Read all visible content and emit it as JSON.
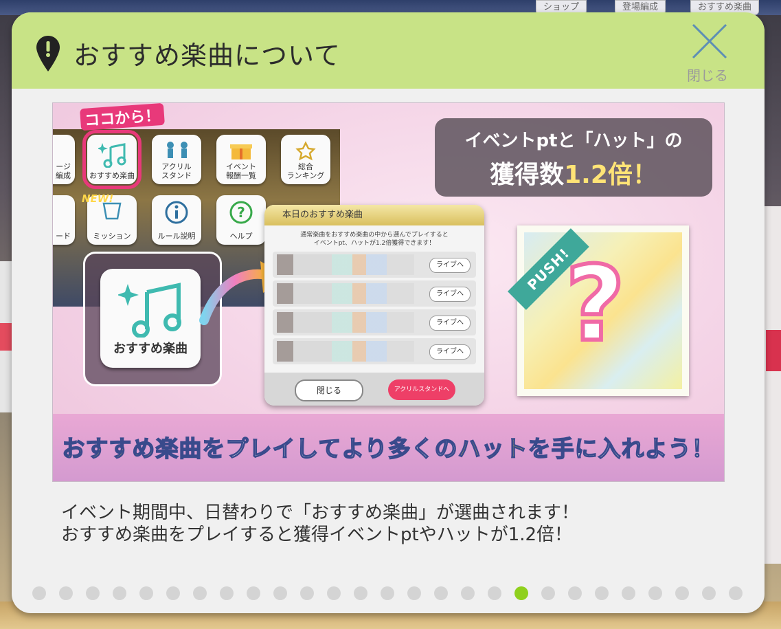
{
  "backdrop": {
    "tabs": [
      "ショップ",
      "登場編成",
      "おすすめ楽曲"
    ]
  },
  "modal": {
    "title": "おすすめ楽曲について",
    "close_label": "閉じる"
  },
  "banner": {
    "start_here": "ココから！",
    "new_tag": "NEW!",
    "tiles": [
      {
        "label": "ージ\n編成"
      },
      {
        "label": "おすすめ楽曲"
      },
      {
        "label": "アクリル\nスタンド"
      },
      {
        "label": "イベント\n報酬一覧"
      },
      {
        "label": "総合\nランキング"
      },
      {
        "label": "ード"
      },
      {
        "label": "ミッション"
      },
      {
        "label": "ルール説明"
      },
      {
        "label": "ヘルプ"
      }
    ],
    "zoom_label": "おすすめ楽曲",
    "dialog": {
      "title": "本日のおすすめ楽曲",
      "desc_line1": "通常楽曲をおすすめ楽曲の中から選んでプレイすると",
      "desc_line2": "イベントpt、ハットが1.2倍獲得できます！",
      "live_label": "ライブへ",
      "close_label": "閉じる",
      "acryl_label": "アクリルスタンドへ"
    },
    "pt_line1": "イベントptと「ハット」の",
    "pt_line2_a": "獲得数",
    "pt_line2_b": "1.2倍！",
    "push_label": "PUSH!",
    "caption_a": "おすすめ楽曲",
    "caption_b": "をプレイしてより多くの",
    "caption_c": "ハット",
    "caption_d": "を手に入れよう！"
  },
  "description": {
    "line1": "イベント期間中、日替わりで「おすすめ楽曲」が選曲されます！",
    "line2": "おすすめ楽曲をプレイすると獲得イベントptやハットが1.2倍！"
  },
  "pager": {
    "total": 27,
    "active_index": 18
  },
  "colors": {
    "header": "#c8e386",
    "active_dot": "#8fd01d",
    "inactive_dot": "#d4d4d4"
  }
}
